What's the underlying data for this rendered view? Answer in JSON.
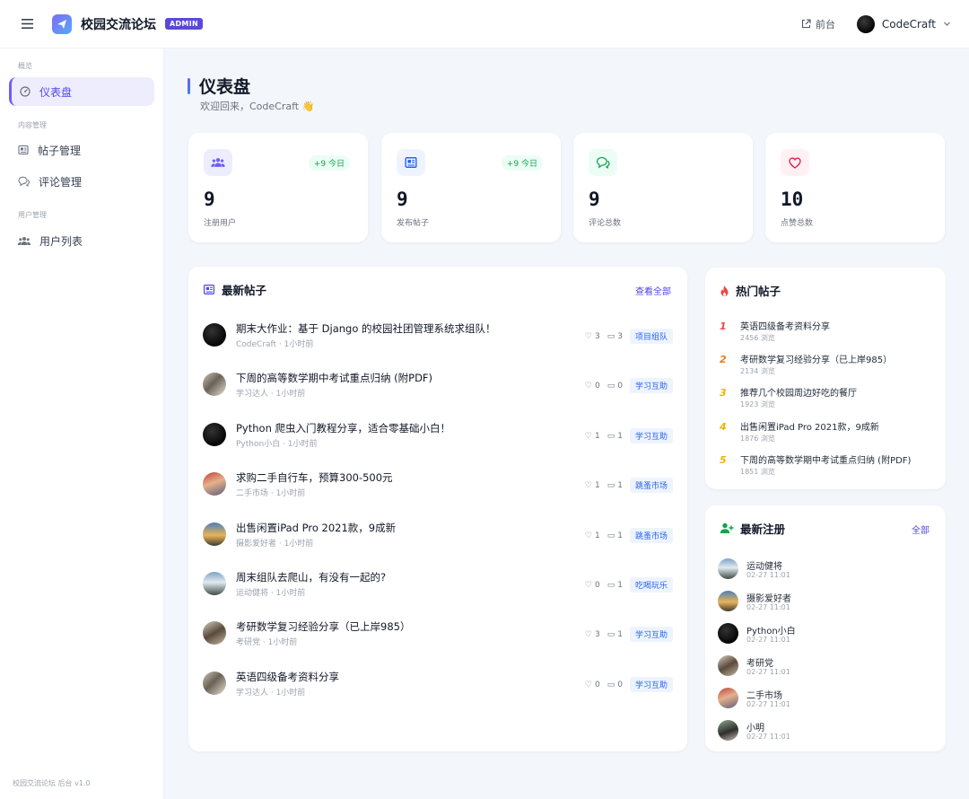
{
  "app": {
    "title": "校园交流论坛",
    "badge": "ADMIN"
  },
  "topbar": {
    "front_label": "前台",
    "user_name": "CodeCraft"
  },
  "sidebar": {
    "sections": [
      {
        "label": "概览"
      },
      {
        "label": "内容管理"
      },
      {
        "label": "用户管理"
      }
    ],
    "items": [
      {
        "label": "仪表盘",
        "icon": "dashboard-icon"
      },
      {
        "label": "帖子管理",
        "icon": "post-icon"
      },
      {
        "label": "评论管理",
        "icon": "comment-icon"
      },
      {
        "label": "用户列表",
        "icon": "users-icon"
      }
    ],
    "footer": "校园交流论坛 后台 v1.0"
  },
  "page": {
    "title": "仪表盘",
    "welcome": "欢迎回来，CodeCraft 👋"
  },
  "stats": [
    {
      "value": "9",
      "label": "注册用户",
      "delta": "+9 今日",
      "color": "#6d5dfc"
    },
    {
      "value": "9",
      "label": "发布帖子",
      "delta": "+9 今日",
      "color": "#2563eb"
    },
    {
      "value": "9",
      "label": "评论总数",
      "delta": "",
      "color": "#16a34a"
    },
    {
      "value": "10",
      "label": "点赞总数",
      "delta": "",
      "color": "#e11d48"
    }
  ],
  "latest_posts": {
    "title": "最新帖子",
    "view_all": "查看全部",
    "items": [
      {
        "title": "期末大作业：基于 Django 的校园社团管理系统求组队！",
        "meta": "CodeCraft · 1小时前",
        "likes": "3",
        "comments": "3",
        "tag": "项目组队"
      },
      {
        "title": "下周的高等数学期中考试重点归纳 (附PDF)",
        "meta": "学习达人 · 1小时前",
        "likes": "0",
        "comments": "0",
        "tag": "学习互助"
      },
      {
        "title": "Python 爬虫入门教程分享，适合零基础小白！",
        "meta": "Python小白 · 1小时前",
        "likes": "1",
        "comments": "1",
        "tag": "学习互助"
      },
      {
        "title": "求购二手自行车，预算300-500元",
        "meta": "二手市场 · 1小时前",
        "likes": "1",
        "comments": "1",
        "tag": "跳蚤市场"
      },
      {
        "title": "出售闲置iPad Pro 2021款，9成新",
        "meta": "摄影爱好者 · 1小时前",
        "likes": "1",
        "comments": "1",
        "tag": "跳蚤市场"
      },
      {
        "title": "周末组队去爬山，有没有一起的?",
        "meta": "运动健将 · 1小时前",
        "likes": "0",
        "comments": "1",
        "tag": "吃喝玩乐"
      },
      {
        "title": "考研数学复习经验分享（已上岸985）",
        "meta": "考研党 · 1小时前",
        "likes": "3",
        "comments": "1",
        "tag": "学习互助"
      },
      {
        "title": "英语四级备考资料分享",
        "meta": "学习达人 · 1小时前",
        "likes": "0",
        "comments": "0",
        "tag": "学习互助"
      }
    ]
  },
  "hot_posts": {
    "title": "热门帖子",
    "items": [
      {
        "rank": "1",
        "title": "英语四级备考资料分享",
        "views": "2456 浏览"
      },
      {
        "rank": "2",
        "title": "考研数学复习经验分享（已上岸985）",
        "views": "2134 浏览"
      },
      {
        "rank": "3",
        "title": "推荐几个校园周边好吃的餐厅",
        "views": "1923 浏览"
      },
      {
        "rank": "4",
        "title": "出售闲置iPad Pro 2021款，9成新",
        "views": "1876 浏览"
      },
      {
        "rank": "5",
        "title": "下周的高等数学期中考试重点归纳 (附PDF)",
        "views": "1851 浏览"
      }
    ]
  },
  "new_users": {
    "title": "最新注册",
    "view_all": "全部",
    "items": [
      {
        "name": "运动健将",
        "time": "02-27 11:01"
      },
      {
        "name": "摄影爱好者",
        "time": "02-27 11:01"
      },
      {
        "name": "Python小白",
        "time": "02-27 11:01"
      },
      {
        "name": "考研党",
        "time": "02-27 11:01"
      },
      {
        "name": "二手市场",
        "time": "02-27 11:01"
      },
      {
        "name": "小明",
        "time": "02-27 11:01"
      }
    ]
  },
  "colors": {
    "accent": "#6d5dfc",
    "link": "#4f46e5",
    "tag": "#2563eb",
    "rank1": "#ef4444",
    "rank2": "#f97316",
    "rank3": "#eab308"
  }
}
